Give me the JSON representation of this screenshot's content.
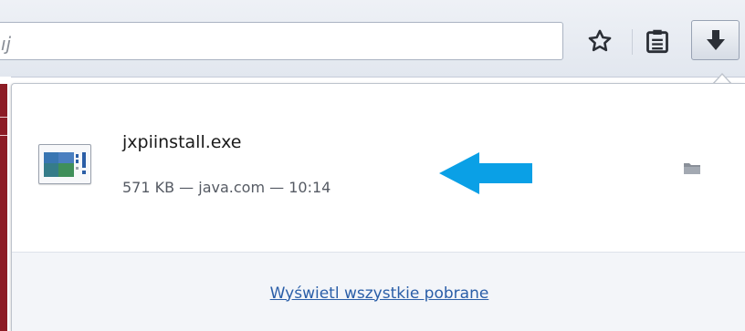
{
  "toolbar": {
    "url_text": "ıj",
    "icons": {
      "bookmark": "star-icon",
      "reading_list": "clipboard-icon",
      "downloads": "download-arrow-icon"
    }
  },
  "downloads_panel": {
    "item": {
      "file_name": "jxpiinstall.exe",
      "status": "571 KB — java.com — 10:14",
      "icon": "file-icon",
      "folder_icon": "folder-icon"
    },
    "annotation_arrow_color": "#0aa0e6",
    "footer_link": "Wyświetl wszystkie pobrane"
  },
  "colors": {
    "link": "#2a5ea8",
    "page_red": "#8c1c25",
    "annotation": "#0aa0e6"
  }
}
